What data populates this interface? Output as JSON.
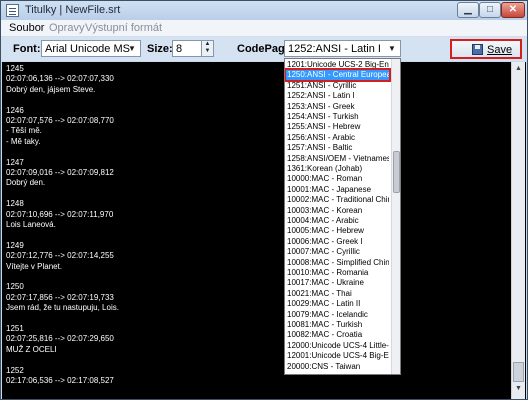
{
  "window": {
    "title": "Titulky | NewFile.srt"
  },
  "menu": {
    "items": [
      {
        "label": "Soubor",
        "enabled": true
      },
      {
        "label": "Opravy",
        "enabled": false
      },
      {
        "label": "Výstupní formát",
        "enabled": false
      }
    ]
  },
  "toolbar": {
    "font_label": "Font:",
    "font_value": "Arial Unicode MS",
    "size_label": "Size:",
    "size_value": "8",
    "codepage_label": "CodePage:",
    "codepage_value": "1252:ANSI - Latin I",
    "save_label": "Save"
  },
  "subtitles": [
    "1245",
    "02:07:06,136 --> 02:07:07,330",
    "Dobrý den, jájsem Steve.",
    "",
    "1246",
    "02:07:07,576 --> 02:07:08,770",
    "- Těší mě.",
    "- Mě taky.",
    "",
    "1247",
    "02:07:09,016 --> 02:07:09,812",
    "Dobrý den.",
    "",
    "1248",
    "02:07:10,696 --> 02:07:11,970",
    "Lois Laneová.",
    "",
    "1249",
    "02:07:12,776 --> 02:07:14,255",
    "Vítejte v Planet.",
    "",
    "1250",
    "02:07:17,856 --> 02:07:19,733",
    "Jsem rád, že tu nastupuju, Lois.",
    "",
    "1251",
    "02:07:25,816 --> 02:07:29,650",
    "MUŽ Z OCELI",
    "",
    "1252",
    "02:17:06,536 --> 02:17:08,527"
  ],
  "codepage_list": {
    "selected_index": 1,
    "items": [
      "1201:Unicode UCS-2 Big-End",
      "1250:ANSI - Central European",
      "1251:ANSI - Cyrillic",
      "1252:ANSI - Latin I",
      "1253:ANSI - Greek",
      "1254:ANSI - Turkish",
      "1255:ANSI - Hebrew",
      "1256:ANSI - Arabic",
      "1257:ANSI - Baltic",
      "1258:ANSI/OEM - Vietnamese",
      "1361:Korean (Johab)",
      "10000:MAC - Roman",
      "10001:MAC - Japanese",
      "10002:MAC - Traditional Chine",
      "10003:MAC - Korean",
      "10004:MAC - Arabic",
      "10005:MAC - Hebrew",
      "10006:MAC - Greek I",
      "10007:MAC - Cyrillic",
      "10008:MAC - Simplified Chines",
      "10010:MAC - Romania",
      "10017:MAC - Ukraine",
      "10021:MAC - Thai",
      "10029:MAC - Latin II",
      "10079:MAC - Icelandic",
      "10081:MAC - Turkish",
      "10082:MAC - Croatia",
      "12000:Unicode UCS-4 Little-E",
      "12001:Unicode UCS-4 Big-En",
      "20000:CNS - Taiwan"
    ]
  },
  "colors": {
    "selection": "#3399ff",
    "highlight_outline": "#d61e1e",
    "editor_bg": "#000000",
    "editor_text": "#ffffff"
  }
}
